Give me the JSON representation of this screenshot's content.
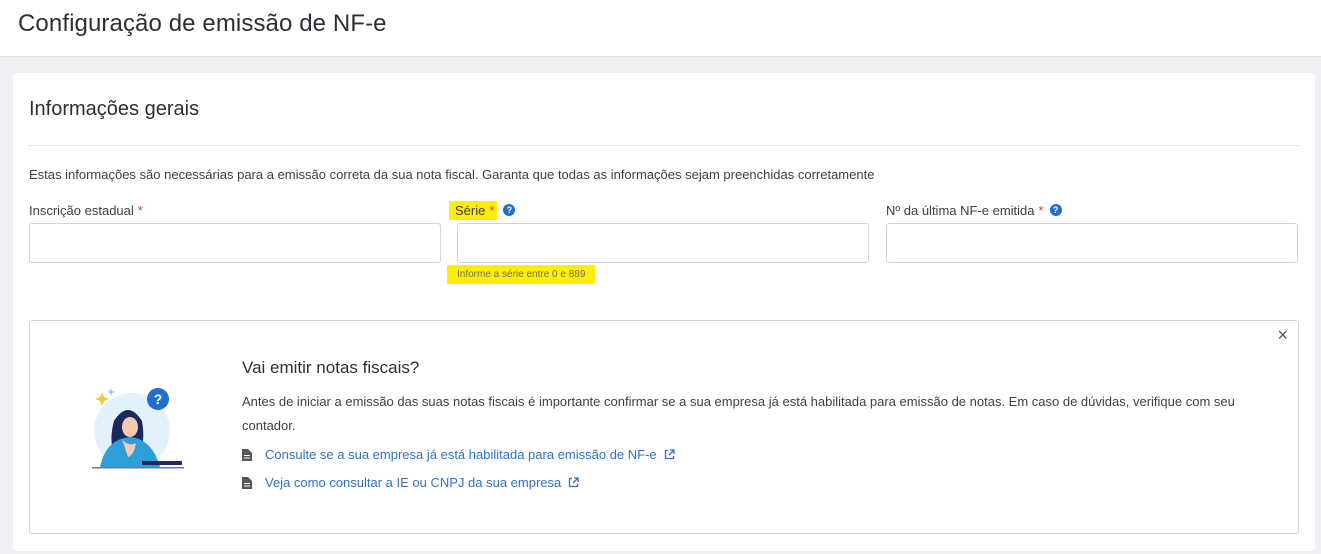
{
  "header": {
    "title": "Configuração de emissão de NF-e"
  },
  "section": {
    "title": "Informações gerais",
    "intro": "Estas informações são necessárias para a emissão correta da sua nota fiscal. Garanta que todas as informações sejam preenchidas corretamente"
  },
  "fields": {
    "ie": {
      "label": "Inscrição estadual",
      "required": "*",
      "value": ""
    },
    "serie": {
      "label": "Série",
      "required": "*",
      "help": "?",
      "value": "",
      "hint": "Informe a série entre 0 e 889"
    },
    "ultima": {
      "label": "Nº da última NF-e emitida",
      "required": "*",
      "help": "?",
      "value": ""
    }
  },
  "info": {
    "close": "×",
    "title": "Vai emitir notas fiscais?",
    "text": " Antes de iniciar a emissão das suas notas fiscais é importante confirmar se a sua empresa já está habilitada para emissão de notas. Em caso de dúvidas, verifique com seu contador.",
    "links": [
      {
        "label": "Consulte se a sua empresa já está habilitada para emissão de NF-e"
      },
      {
        "label": "Veja como consultar a IE ou CNPJ da sua empresa"
      }
    ]
  },
  "colors": {
    "accent": "#2e72c9",
    "highlight": "#ffee00",
    "required": "#d9363e"
  }
}
